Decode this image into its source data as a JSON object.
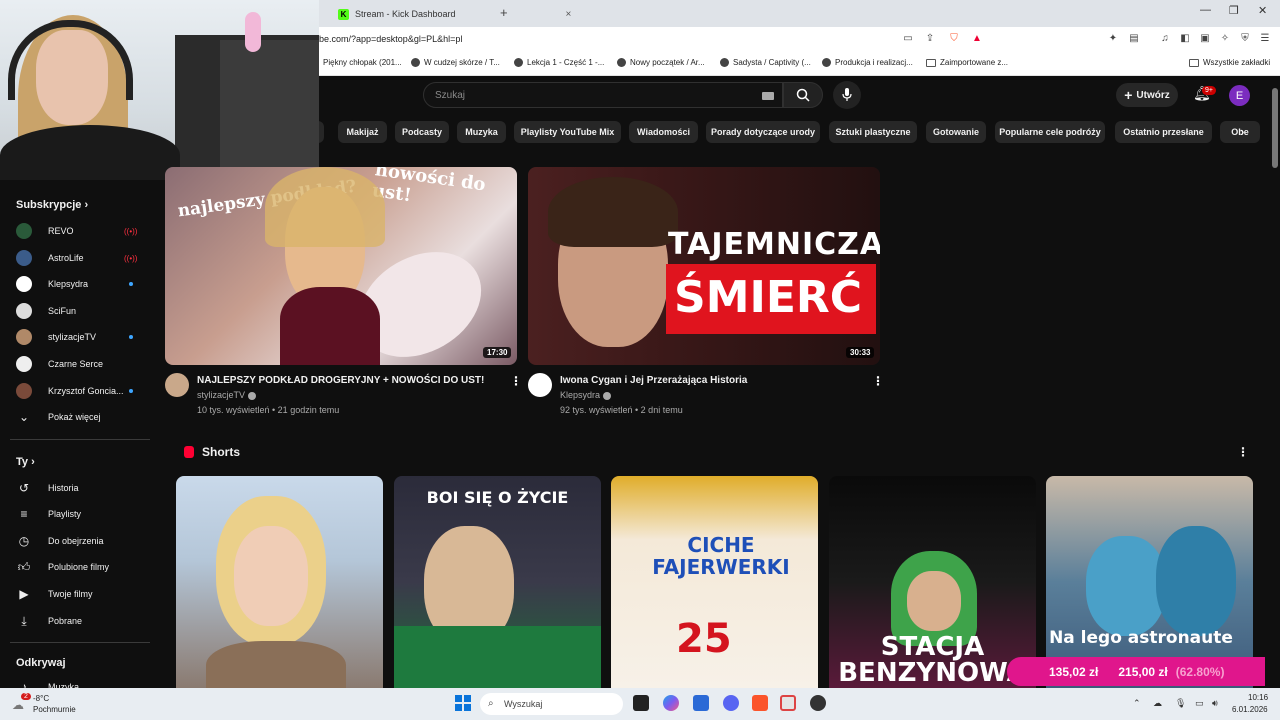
{
  "browser": {
    "tab_title": "Stream - Kick Dashboard",
    "url": "be.com/?app=desktop&gl=PL&hl=pl",
    "bookmarks": [
      "Piękny chłopak (201...",
      "W cudzej skórze / T...",
      "Lekcja 1 - Część 1 -...",
      "Nowy początek / Ar...",
      "Sadysta / Captivity (...",
      "Produkcja i realizacj...",
      "Zaimportowane z..."
    ],
    "all_bookmarks": "Wszystkie zakładki"
  },
  "header": {
    "search_placeholder": "Szukaj",
    "create_label": "Utwórz",
    "notification_count": "9+",
    "avatar_letter": "E"
  },
  "chips": [
    "o",
    "Makijaż",
    "Podcasty",
    "Muzyka",
    "Playlisty YouTube Mix",
    "Wiadomości",
    "Porady dotyczące urody",
    "Sztuki plastyczne",
    "Gotowanie",
    "Popularne cele podróży",
    "Ostatnio przesłane",
    "Obe"
  ],
  "sidebar": {
    "subscriptions_title": "Subskrypcje",
    "subscriptions": [
      {
        "name": "REVO",
        "status": "live"
      },
      {
        "name": "AstroLife",
        "status": "live"
      },
      {
        "name": "Klepsydra",
        "status": "new"
      },
      {
        "name": "SciFun",
        "status": ""
      },
      {
        "name": "stylizacjeTV",
        "status": "new"
      },
      {
        "name": "Czarne Serce",
        "status": ""
      },
      {
        "name": "Krzysztof Goncia...",
        "status": "new"
      }
    ],
    "show_more": "Pokaż więcej",
    "you_title": "Ty",
    "you_items": [
      "Historia",
      "Playlisty",
      "Do obejrzenia",
      "Polubione filmy",
      "Twoje filmy",
      "Pobrane"
    ],
    "explore_title": "Odkrywaj",
    "explore_items": [
      "Muzyka"
    ]
  },
  "videos": [
    {
      "title": "NAJLEPSZY PODKŁAD DROGERYJNY + NOWOŚCI DO UST!",
      "channel": "stylizacjeTV",
      "meta": "10 tys. wyświetleń • 21 godzin temu",
      "duration": "17:30",
      "thumb_text_1": "nowości do ust!",
      "thumb_text_2": "najlepszy podkład?"
    },
    {
      "title": "Iwona Cygan i Jej Przerażająca Historia",
      "channel": "Klepsydra",
      "meta": "92 tys. wyświetleń • 2 dni temu",
      "duration": "30:33",
      "thumb_text_1": "TAJEMNICZA",
      "thumb_text_2": "ŚMIERĆ"
    }
  ],
  "shorts": {
    "title": "Shorts",
    "items": [
      {
        "overlay": ""
      },
      {
        "overlay": "BOI SIĘ O ŻYCIE"
      },
      {
        "overlay": "CICHE FAJERWERKI"
      },
      {
        "overlay": "STACJA BENZYNOWA"
      },
      {
        "overlay": "Na lego astronaute"
      }
    ]
  },
  "overlay_price": {
    "price1": "135,02 zł",
    "price2": "215,00 zł",
    "pct": "(62.80%)"
  },
  "taskbar": {
    "weather_temp": "-8°C",
    "weather_desc": "Pochmurnie",
    "weather_badge": "2",
    "search": "Wyszukaj",
    "time": "10:16",
    "date": "6.01.2026"
  },
  "colors": {
    "bg": "#0f0f0f",
    "chip": "#272727",
    "accent_red": "#ff0033",
    "price_pink": "#e0168c"
  }
}
